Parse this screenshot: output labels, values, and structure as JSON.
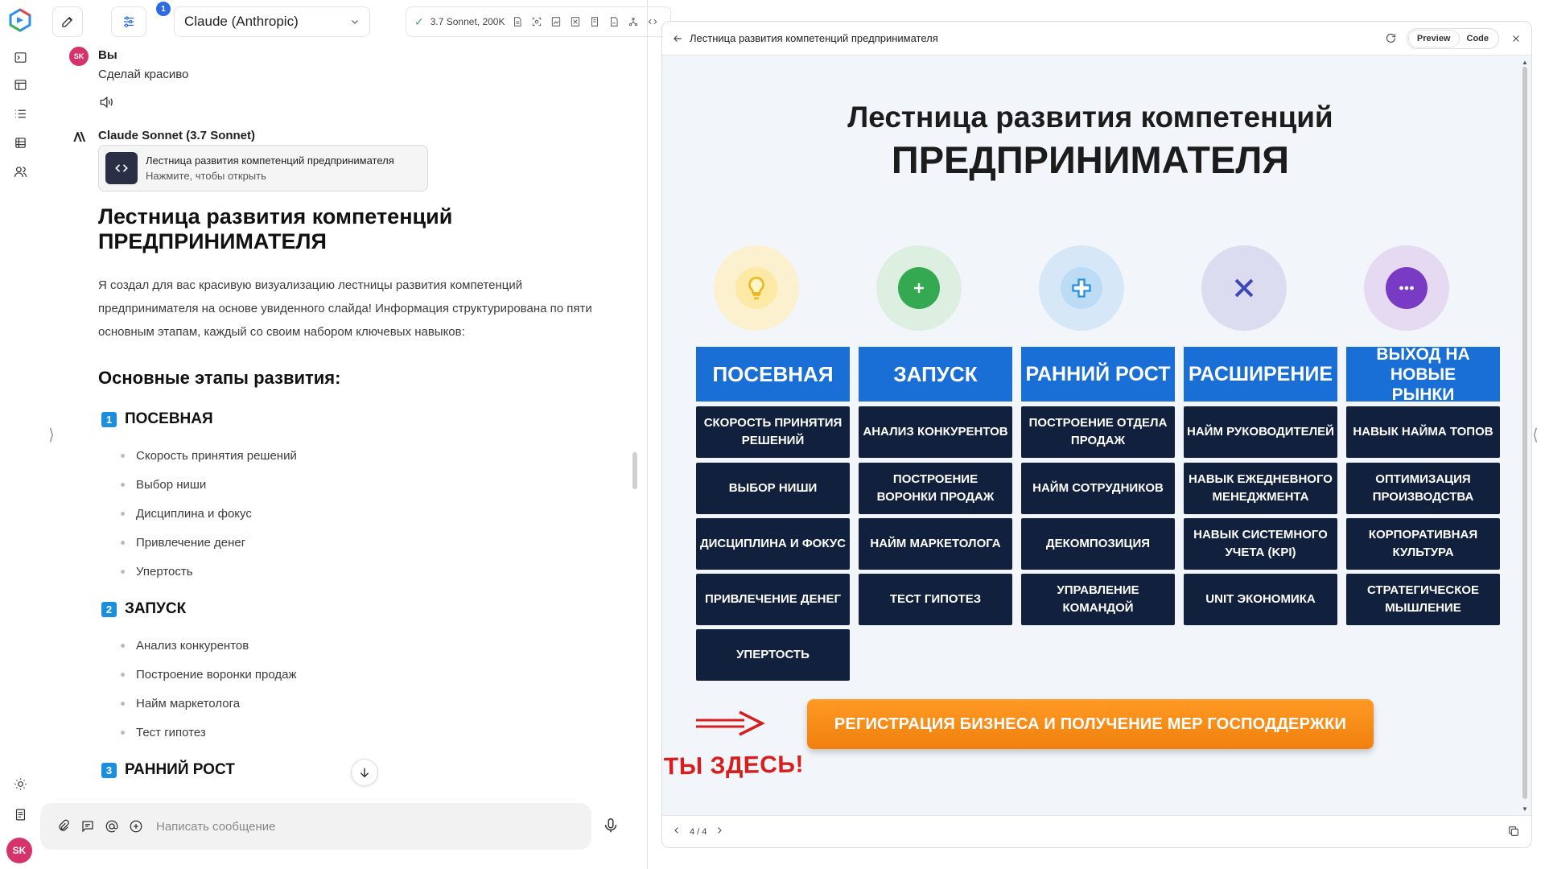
{
  "header": {
    "tools_badge": "1",
    "model": "Claude (Anthropic)",
    "model_info": "3.7 Sonnet, 200K"
  },
  "user": {
    "initials": "SK",
    "name": "Вы",
    "message": "Сделай красиво"
  },
  "assistant": {
    "name": "Claude Sonnet (3.7 Sonnet)",
    "artifact_title": "Лестница развития компетенций предпринимателя",
    "artifact_hint": "Нажмите, чтобы открыть",
    "heading_line1": "Лестница развития компетенций",
    "heading_line2": "ПРЕДПРИНИМАТЕЛЯ",
    "paragraph": "Я создал для вас красивую визуализацию лестницы развития компетенций предпринимателя на основе увиденного слайда! Информация структурирована по пяти основным этапам, каждый со своим набором ключевых навыков:",
    "subheading": "Основные этапы развития:",
    "stages": [
      {
        "num": "1",
        "title": "ПОСЕВНАЯ",
        "items": [
          "Скорость принятия решений",
          "Выбор ниши",
          "Дисциплина и фокус",
          "Привлечение денег",
          "Упертость"
        ]
      },
      {
        "num": "2",
        "title": "ЗАПУСК",
        "items": [
          "Анализ конкурентов",
          "Построение воронки продаж",
          "Найм маркетолога",
          "Тест гипотез"
        ]
      },
      {
        "num": "3",
        "title": "РАННИЙ РОСТ",
        "items": []
      }
    ]
  },
  "composer": {
    "placeholder": "Написать сообщение"
  },
  "panel": {
    "title": "Лестница развития компетенций предпринимателя",
    "tab_preview": "Preview",
    "tab_code": "Code",
    "active_tab": "Preview",
    "pager": "4 / 4"
  },
  "slide": {
    "title1": "Лестница развития компетенций",
    "title2": "ПРЕДПРИНИМАТЕЛЯ",
    "columns": [
      {
        "header": "ПОСЕВНАЯ",
        "icon": "lightbulb-icon",
        "cells": [
          "СКОРОСТЬ ПРИНЯТИЯ РЕШЕНИЙ",
          "ВЫБОР НИШИ",
          "ДИСЦИПЛИНА И ФОКУС",
          "ПРИВЛЕЧЕНИЕ ДЕНЕГ",
          "УПЕРТОСТЬ"
        ]
      },
      {
        "header": "ЗАПУСК",
        "icon": "plus-circle-icon",
        "cells": [
          "АНАЛИЗ КОНКУРЕНТОВ",
          "ПОСТРОЕНИЕ ВОРОНКИ ПРОДАЖ",
          "НАЙМ МАРКЕТОЛОГА",
          "ТЕСТ ГИПОТЕЗ"
        ]
      },
      {
        "header": "РАННИЙ РОСТ",
        "icon": "medical-cross-icon",
        "cells": [
          "ПОСТРОЕНИЕ ОТДЕЛА ПРОДАЖ",
          "НАЙМ СОТРУДНИКОВ",
          "ДЕКОМПОЗИЦИЯ",
          "УПРАВЛЕНИЕ КОМАНДОЙ"
        ]
      },
      {
        "header": "РАСШИРЕНИЕ",
        "icon": "x-mark-icon",
        "cells": [
          "НАЙМ РУКОВОДИТЕЛЕЙ",
          "НАВЫК ЕЖЕДНЕВНОГО МЕНЕДЖМЕНТА",
          "НАВЫК СИСТЕМНОГО УЧЕТА (KPI)",
          "UNIT ЭКОНОМИКА"
        ]
      },
      {
        "header": "ВЫХОД НА НОВЫЕ РЫНКИ",
        "icon": "more-dots-icon",
        "cells": [
          "НАВЫК НАЙМА ТОПОВ",
          "ОПТИМИЗАЦИЯ ПРОИЗВОДСТВА",
          "КОРПОРАТИВНАЯ КУЛЬТУРА",
          "СТРАТЕГИЧЕСКОЕ МЫШЛЕНИЕ"
        ]
      }
    ],
    "register_button": "РЕГИСТРАЦИЯ БИЗНЕСА И ПОЛУЧЕНИЕ МЕР ГОСПОДДЕРЖКИ",
    "you_are_here": "ТЫ ЗДЕСЬ!"
  },
  "colors": {
    "column_header": "#1a6fd6",
    "cell": "#11203d",
    "accent_orange": "#f0800e",
    "accent_red": "#d71e1e"
  }
}
